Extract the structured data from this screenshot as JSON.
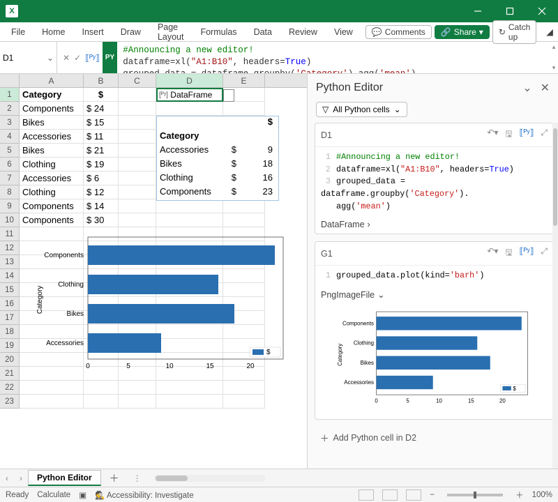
{
  "app": {
    "name": "X"
  },
  "window_buttons": {
    "min": "minimize",
    "max": "restore",
    "close": "close"
  },
  "ribbon": {
    "tabs": [
      "File",
      "Home",
      "Insert",
      "Draw",
      "Page Layout",
      "Formulas",
      "Data",
      "Review",
      "View"
    ],
    "comments": "Comments",
    "share": "Share",
    "catchup": "Catch up"
  },
  "formula": {
    "name_box": "D1",
    "py_badge": "PY",
    "code": {
      "l1": "#Announcing a new editor!",
      "l2a": "dataframe=xl(",
      "l2s": "\"A1:B10\"",
      "l2b": ", headers=",
      "l2k": "True",
      "l2c": ")",
      "l3a": "grouped_data = dataframe.groupby(",
      "l3s1": "'Category'",
      "l3b": ").agg(",
      "l3s2": "'mean'",
      "l3c": ")"
    }
  },
  "columns": [
    "A",
    "B",
    "C",
    "D",
    "E"
  ],
  "rownums": [
    "1",
    "2",
    "3",
    "4",
    "5",
    "6",
    "7",
    "8",
    "9",
    "10",
    "11",
    "12",
    "13",
    "14",
    "15",
    "16",
    "17",
    "18",
    "19",
    "20",
    "21",
    "22",
    "23"
  ],
  "sheet": {
    "header": {
      "a": "Category",
      "b": "$"
    },
    "rows": [
      {
        "a": "Components",
        "b": "$  24"
      },
      {
        "a": "Bikes",
        "b": "$  15"
      },
      {
        "a": "Accessories",
        "b": "$  11"
      },
      {
        "a": "Bikes",
        "b": "$  21"
      },
      {
        "a": "Clothing",
        "b": "$  19"
      },
      {
        "a": "Accessories",
        "b": "$    6"
      },
      {
        "a": "Clothing",
        "b": "$  12"
      },
      {
        "a": "Components",
        "b": "$  14"
      },
      {
        "a": "Components",
        "b": "$  30"
      }
    ],
    "d1_label": "DataFrame"
  },
  "grouped": {
    "title_cat": "Category",
    "title_val": "$",
    "rows": [
      {
        "cat": "Accessories",
        "d": "$",
        "v": "9"
      },
      {
        "cat": "Bikes",
        "d": "$",
        "v": "18"
      },
      {
        "cat": "Clothing",
        "d": "$",
        "v": "16"
      },
      {
        "cat": "Components",
        "d": "$",
        "v": "23"
      }
    ]
  },
  "chart_data": {
    "type": "bar",
    "orientation": "horizontal",
    "categories": [
      "Accessories",
      "Bikes",
      "Clothing",
      "Components"
    ],
    "display_order": [
      "Components",
      "Clothing",
      "Bikes",
      "Accessories"
    ],
    "values": [
      9,
      18,
      16,
      23
    ],
    "legend": "$",
    "xlabel": "",
    "ylabel": "Category",
    "ticks": [
      "0",
      "5",
      "10",
      "15",
      "20"
    ],
    "xlim": [
      0,
      24
    ]
  },
  "panel": {
    "title": "Python Editor",
    "filter": "All Python cells",
    "card1": {
      "ref": "D1",
      "code": {
        "l1": "#Announcing a new editor!",
        "l2a": "dataframe=xl(",
        "l2s": "\"A1:B10\"",
        "l2b": ", headers=",
        "l2k": "True",
        "l2c": ")",
        "l3a": "grouped_data = dataframe.groupby(",
        "l3s": "'Category'",
        "l3b": ").",
        "l4a": "agg(",
        "l4s": "'mean'",
        "l4b": ")"
      },
      "output": "DataFrame"
    },
    "card2": {
      "ref": "G1",
      "code": {
        "l1a": "grouped_data.plot(kind=",
        "l1s": "'barh'",
        "l1b": ")"
      },
      "output": "PngImageFile"
    },
    "add": "Add Python cell in D2"
  },
  "sheet_tab": "Python Editor",
  "status": {
    "ready": "Ready",
    "calc": "Calculate",
    "access": "Accessibility: Investigate",
    "zoom": "100%"
  }
}
